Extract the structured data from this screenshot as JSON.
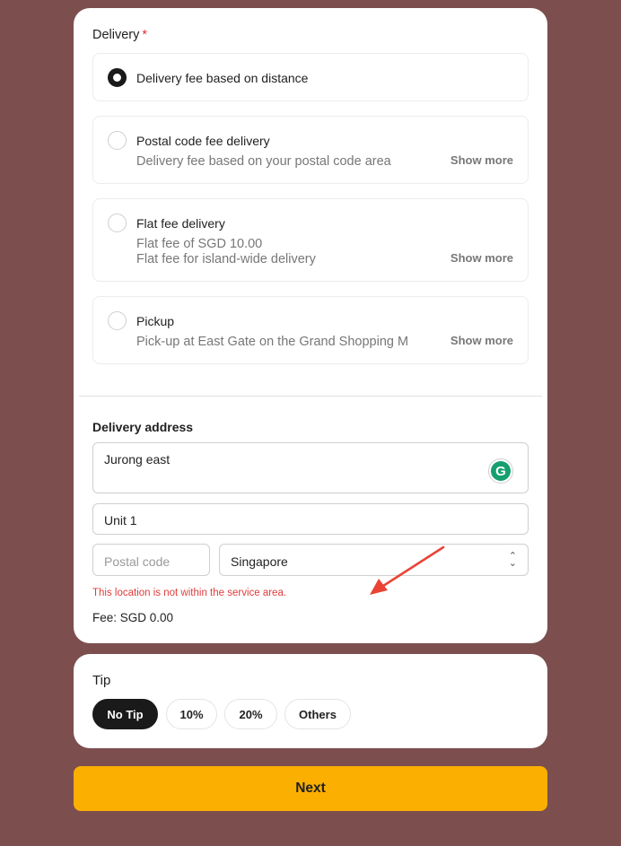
{
  "delivery": {
    "title": "Delivery",
    "required_mark": "*",
    "options": [
      {
        "title": "Delivery fee based on distance",
        "selected": true
      },
      {
        "title": "Postal code fee delivery",
        "desc": [
          "Delivery fee based on your postal code area"
        ],
        "show_more": "Show more",
        "selected": false
      },
      {
        "title": "Flat fee delivery",
        "desc": [
          "Flat fee of SGD 10.00",
          "Flat fee for island-wide delivery"
        ],
        "show_more": "Show more",
        "selected": false
      },
      {
        "title": "Pickup",
        "desc": [
          "Pick-up at East Gate on the Grand Shopping M"
        ],
        "show_more": "Show more",
        "selected": false
      }
    ]
  },
  "address": {
    "title": "Delivery address",
    "street": "Jurong east",
    "unit": "Unit 1",
    "postal_placeholder": "Postal code",
    "country": "Singapore",
    "error": "This location is not within the service area.",
    "fee": "Fee: SGD 0.00",
    "grammarly_letter": "G"
  },
  "tip": {
    "title": "Tip",
    "options": [
      "No Tip",
      "10%",
      "20%",
      "Others"
    ],
    "selected": "No Tip"
  },
  "next_label": "Next",
  "colors": {
    "background": "#7c4f4e",
    "accent": "#fbaf01",
    "error": "#e03c3c",
    "selected": "#1a1a1a"
  }
}
